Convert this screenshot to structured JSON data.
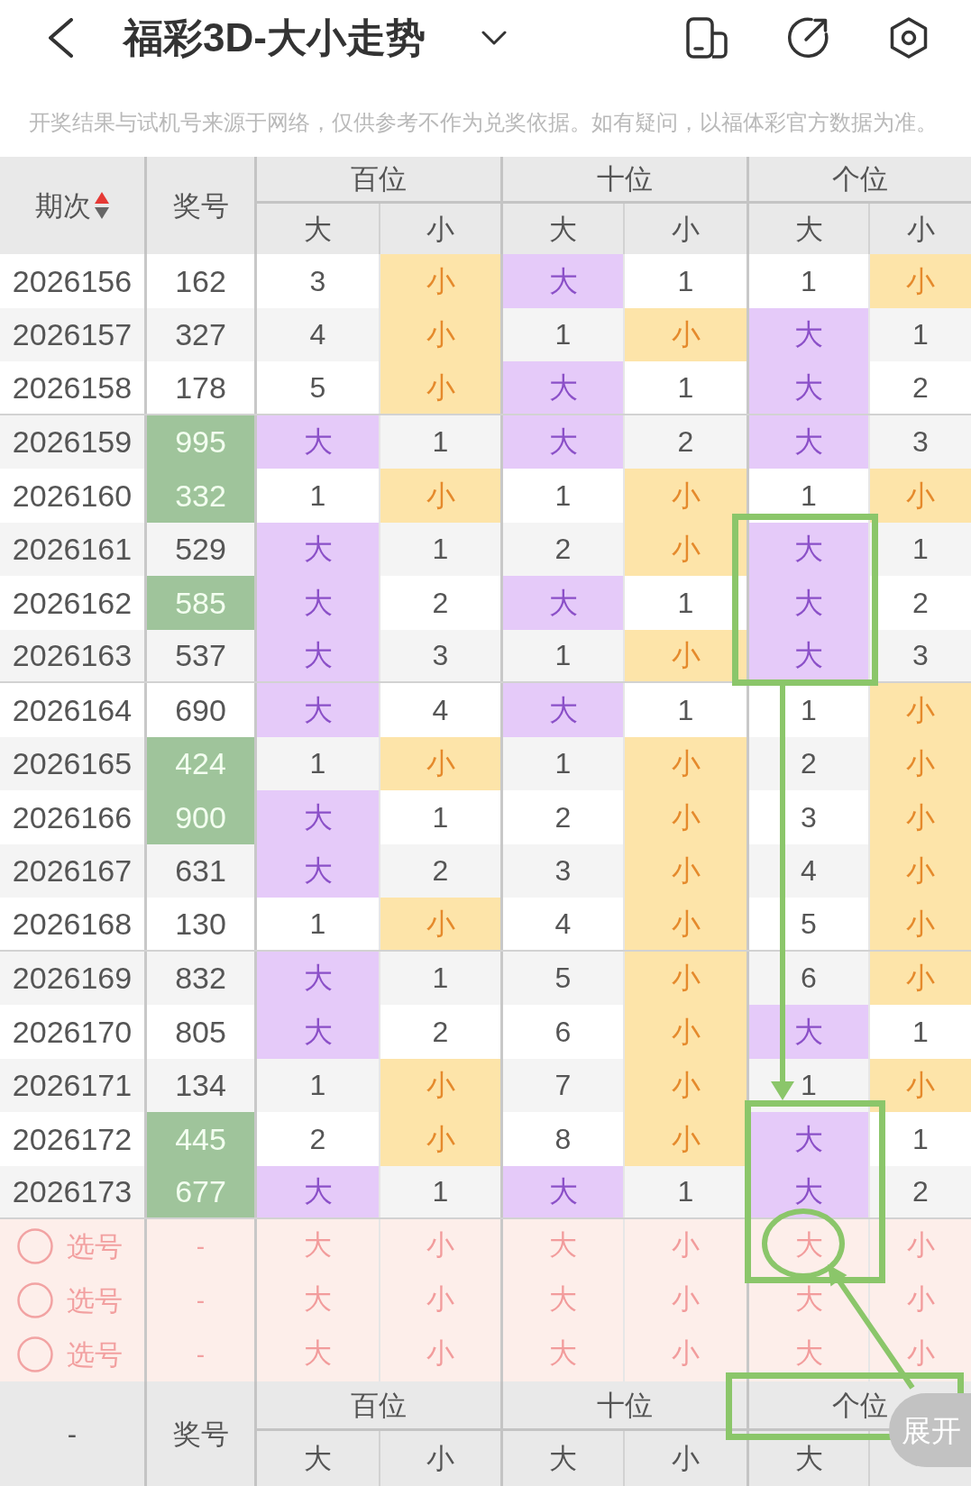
{
  "header": {
    "title": "福彩3D-大小走势"
  },
  "notice": "开奖结果与试机号来源于网络，仅供参考不作为兑奖依据。如有疑问，以福体彩官方数据为准。",
  "table": {
    "sort_ascending": true,
    "columns": {
      "period": "期次",
      "number": "奖号",
      "groups": [
        {
          "label": "百位",
          "subs": [
            "大",
            "小"
          ]
        },
        {
          "label": "十位",
          "subs": [
            "大",
            "小"
          ]
        },
        {
          "label": "个位",
          "subs": [
            "大",
            "小"
          ]
        }
      ]
    },
    "rows": [
      {
        "period": "2026156",
        "number": "162",
        "highlighted": false,
        "cells": [
          {
            "kind": "miss",
            "text": "3"
          },
          {
            "kind": "small",
            "text": "小"
          },
          {
            "kind": "big",
            "text": "大"
          },
          {
            "kind": "miss",
            "text": "1"
          },
          {
            "kind": "miss",
            "text": "1"
          },
          {
            "kind": "small",
            "text": "小"
          }
        ]
      },
      {
        "period": "2026157",
        "number": "327",
        "highlighted": false,
        "cells": [
          {
            "kind": "miss",
            "text": "4"
          },
          {
            "kind": "small",
            "text": "小"
          },
          {
            "kind": "miss",
            "text": "1"
          },
          {
            "kind": "small",
            "text": "小"
          },
          {
            "kind": "big",
            "text": "大"
          },
          {
            "kind": "miss",
            "text": "1"
          }
        ]
      },
      {
        "period": "2026158",
        "number": "178",
        "highlighted": false,
        "cells": [
          {
            "kind": "miss",
            "text": "5"
          },
          {
            "kind": "small",
            "text": "小"
          },
          {
            "kind": "big",
            "text": "大"
          },
          {
            "kind": "miss",
            "text": "1"
          },
          {
            "kind": "big",
            "text": "大"
          },
          {
            "kind": "miss",
            "text": "2"
          }
        ]
      },
      {
        "period": "2026159",
        "number": "995",
        "highlighted": true,
        "cells": [
          {
            "kind": "big",
            "text": "大"
          },
          {
            "kind": "miss",
            "text": "1"
          },
          {
            "kind": "big",
            "text": "大"
          },
          {
            "kind": "miss",
            "text": "2"
          },
          {
            "kind": "big",
            "text": "大"
          },
          {
            "kind": "miss",
            "text": "3"
          }
        ]
      },
      {
        "period": "2026160",
        "number": "332",
        "highlighted": true,
        "cells": [
          {
            "kind": "miss",
            "text": "1"
          },
          {
            "kind": "small",
            "text": "小"
          },
          {
            "kind": "miss",
            "text": "1"
          },
          {
            "kind": "small",
            "text": "小"
          },
          {
            "kind": "miss",
            "text": "1"
          },
          {
            "kind": "small",
            "text": "小"
          }
        ]
      },
      {
        "period": "2026161",
        "number": "529",
        "highlighted": false,
        "cells": [
          {
            "kind": "big",
            "text": "大"
          },
          {
            "kind": "miss",
            "text": "1"
          },
          {
            "kind": "miss",
            "text": "2"
          },
          {
            "kind": "small",
            "text": "小"
          },
          {
            "kind": "big",
            "text": "大"
          },
          {
            "kind": "miss",
            "text": "1"
          }
        ]
      },
      {
        "period": "2026162",
        "number": "585",
        "highlighted": true,
        "cells": [
          {
            "kind": "big",
            "text": "大"
          },
          {
            "kind": "miss",
            "text": "2"
          },
          {
            "kind": "big",
            "text": "大"
          },
          {
            "kind": "miss",
            "text": "1"
          },
          {
            "kind": "big",
            "text": "大"
          },
          {
            "kind": "miss",
            "text": "2"
          }
        ]
      },
      {
        "period": "2026163",
        "number": "537",
        "highlighted": false,
        "cells": [
          {
            "kind": "big",
            "text": "大"
          },
          {
            "kind": "miss",
            "text": "3"
          },
          {
            "kind": "miss",
            "text": "1"
          },
          {
            "kind": "small",
            "text": "小"
          },
          {
            "kind": "big",
            "text": "大"
          },
          {
            "kind": "miss",
            "text": "3"
          }
        ]
      },
      {
        "period": "2026164",
        "number": "690",
        "highlighted": false,
        "cells": [
          {
            "kind": "big",
            "text": "大"
          },
          {
            "kind": "miss",
            "text": "4"
          },
          {
            "kind": "big",
            "text": "大"
          },
          {
            "kind": "miss",
            "text": "1"
          },
          {
            "kind": "miss",
            "text": "1"
          },
          {
            "kind": "small",
            "text": "小"
          }
        ]
      },
      {
        "period": "2026165",
        "number": "424",
        "highlighted": true,
        "cells": [
          {
            "kind": "miss",
            "text": "1"
          },
          {
            "kind": "small",
            "text": "小"
          },
          {
            "kind": "miss",
            "text": "1"
          },
          {
            "kind": "small",
            "text": "小"
          },
          {
            "kind": "miss",
            "text": "2"
          },
          {
            "kind": "small",
            "text": "小"
          }
        ]
      },
      {
        "period": "2026166",
        "number": "900",
        "highlighted": true,
        "cells": [
          {
            "kind": "big",
            "text": "大"
          },
          {
            "kind": "miss",
            "text": "1"
          },
          {
            "kind": "miss",
            "text": "2"
          },
          {
            "kind": "small",
            "text": "小"
          },
          {
            "kind": "miss",
            "text": "3"
          },
          {
            "kind": "small",
            "text": "小"
          }
        ]
      },
      {
        "period": "2026167",
        "number": "631",
        "highlighted": false,
        "cells": [
          {
            "kind": "big",
            "text": "大"
          },
          {
            "kind": "miss",
            "text": "2"
          },
          {
            "kind": "miss",
            "text": "3"
          },
          {
            "kind": "small",
            "text": "小"
          },
          {
            "kind": "miss",
            "text": "4"
          },
          {
            "kind": "small",
            "text": "小"
          }
        ]
      },
      {
        "period": "2026168",
        "number": "130",
        "highlighted": false,
        "cells": [
          {
            "kind": "miss",
            "text": "1"
          },
          {
            "kind": "small",
            "text": "小"
          },
          {
            "kind": "miss",
            "text": "4"
          },
          {
            "kind": "small",
            "text": "小"
          },
          {
            "kind": "miss",
            "text": "5"
          },
          {
            "kind": "small",
            "text": "小"
          }
        ]
      },
      {
        "period": "2026169",
        "number": "832",
        "highlighted": false,
        "cells": [
          {
            "kind": "big",
            "text": "大"
          },
          {
            "kind": "miss",
            "text": "1"
          },
          {
            "kind": "miss",
            "text": "5"
          },
          {
            "kind": "small",
            "text": "小"
          },
          {
            "kind": "miss",
            "text": "6"
          },
          {
            "kind": "small",
            "text": "小"
          }
        ]
      },
      {
        "period": "2026170",
        "number": "805",
        "highlighted": false,
        "cells": [
          {
            "kind": "big",
            "text": "大"
          },
          {
            "kind": "miss",
            "text": "2"
          },
          {
            "kind": "miss",
            "text": "6"
          },
          {
            "kind": "small",
            "text": "小"
          },
          {
            "kind": "big",
            "text": "大"
          },
          {
            "kind": "miss",
            "text": "1"
          }
        ]
      },
      {
        "period": "2026171",
        "number": "134",
        "highlighted": false,
        "cells": [
          {
            "kind": "miss",
            "text": "1"
          },
          {
            "kind": "small",
            "text": "小"
          },
          {
            "kind": "miss",
            "text": "7"
          },
          {
            "kind": "small",
            "text": "小"
          },
          {
            "kind": "miss",
            "text": "1"
          },
          {
            "kind": "small",
            "text": "小"
          }
        ]
      },
      {
        "period": "2026172",
        "number": "445",
        "highlighted": true,
        "cells": [
          {
            "kind": "miss",
            "text": "2"
          },
          {
            "kind": "small",
            "text": "小"
          },
          {
            "kind": "miss",
            "text": "8"
          },
          {
            "kind": "small",
            "text": "小"
          },
          {
            "kind": "big",
            "text": "大"
          },
          {
            "kind": "miss",
            "text": "1"
          }
        ]
      },
      {
        "period": "2026173",
        "number": "677",
        "highlighted": true,
        "cells": [
          {
            "kind": "big",
            "text": "大"
          },
          {
            "kind": "miss",
            "text": "1"
          },
          {
            "kind": "big",
            "text": "大"
          },
          {
            "kind": "miss",
            "text": "1"
          },
          {
            "kind": "big",
            "text": "大"
          },
          {
            "kind": "miss",
            "text": "2"
          }
        ]
      }
    ],
    "pick_rows": [
      {
        "selected": false,
        "label": "选号",
        "number": "-",
        "options": [
          "大",
          "小",
          "大",
          "小",
          "大",
          "小"
        ]
      },
      {
        "selected": false,
        "label": "选号",
        "number": "-",
        "options": [
          "大",
          "小",
          "大",
          "小",
          "大",
          "小"
        ]
      },
      {
        "selected": false,
        "label": "选号",
        "number": "-",
        "options": [
          "大",
          "小",
          "大",
          "小",
          "大",
          "小"
        ]
      }
    ],
    "footer": {
      "period": "-",
      "number": "奖号",
      "groups": [
        "百位",
        "十位",
        "个位"
      ],
      "subs": [
        "大",
        "小",
        "大",
        "小",
        "大"
      ]
    }
  },
  "expand_button": "展开"
}
